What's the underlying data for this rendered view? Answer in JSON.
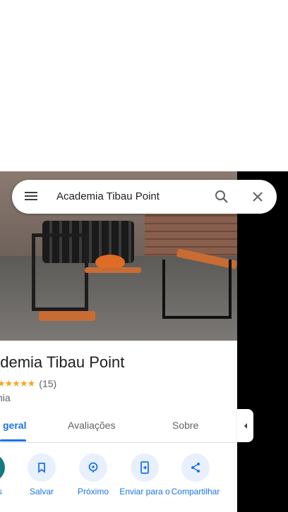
{
  "search": {
    "query": "Academia Tibau Point"
  },
  "place": {
    "title": "ademia Tibau Point",
    "stars": "★★★★★",
    "rating_count": "(15)",
    "category": "nia"
  },
  "tabs": [
    {
      "label": "geral",
      "active": true
    },
    {
      "label": "Avaliações",
      "active": false
    },
    {
      "label": "Sobre",
      "active": false
    }
  ],
  "actions": {
    "edge_label": "s",
    "save": "Salvar",
    "nearby": "Próximo",
    "send": "Enviar para o",
    "share": "Compartilhar"
  },
  "colors": {
    "accent": "#1a73e8",
    "teal": "#137a7f",
    "star": "#f5a623"
  },
  "icons": {
    "menu": "menu-icon",
    "search": "search-icon",
    "close": "close-icon",
    "bookmark": "bookmark-icon",
    "nearby": "nearby-icon",
    "send": "send-to-phone-icon",
    "share": "share-icon",
    "collapse": "chevron-left-icon"
  }
}
